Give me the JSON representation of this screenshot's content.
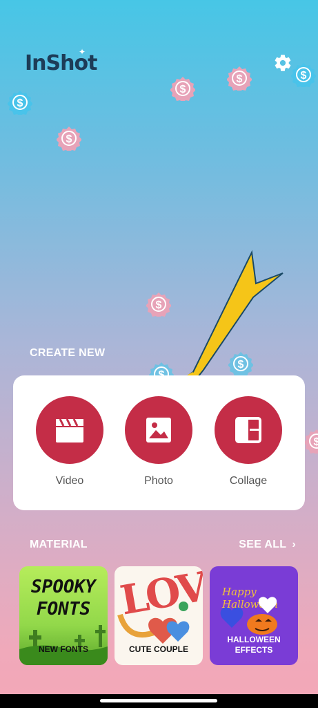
{
  "app": {
    "logo": "InShot"
  },
  "icons": {
    "settings": "gear-icon",
    "video": "clapperboard-icon",
    "photo": "image-icon",
    "collage": "collage-grid-icon",
    "see_all_chevron": "chevron-right-icon",
    "coin": "dollar-coin-icon"
  },
  "create": {
    "title": "CREATE NEW",
    "tools": [
      {
        "label": "Video"
      },
      {
        "label": "Photo"
      },
      {
        "label": "Collage"
      }
    ]
  },
  "material": {
    "title": "MATERIAL",
    "see_all": "SEE ALL",
    "cards": [
      {
        "label": "NEW FONTS",
        "art_text": "SPOOKY FONTS"
      },
      {
        "label": "CUTE COUPLE",
        "art_text": "LOVE"
      },
      {
        "label": "HALLOWEEN EFFECTS",
        "art_text": "Happy Halloween"
      }
    ]
  },
  "colors": {
    "accent": "#c42d47",
    "logo": "#1d3c57",
    "arrow": "#f5c518",
    "card_bg": "#ffffff"
  }
}
